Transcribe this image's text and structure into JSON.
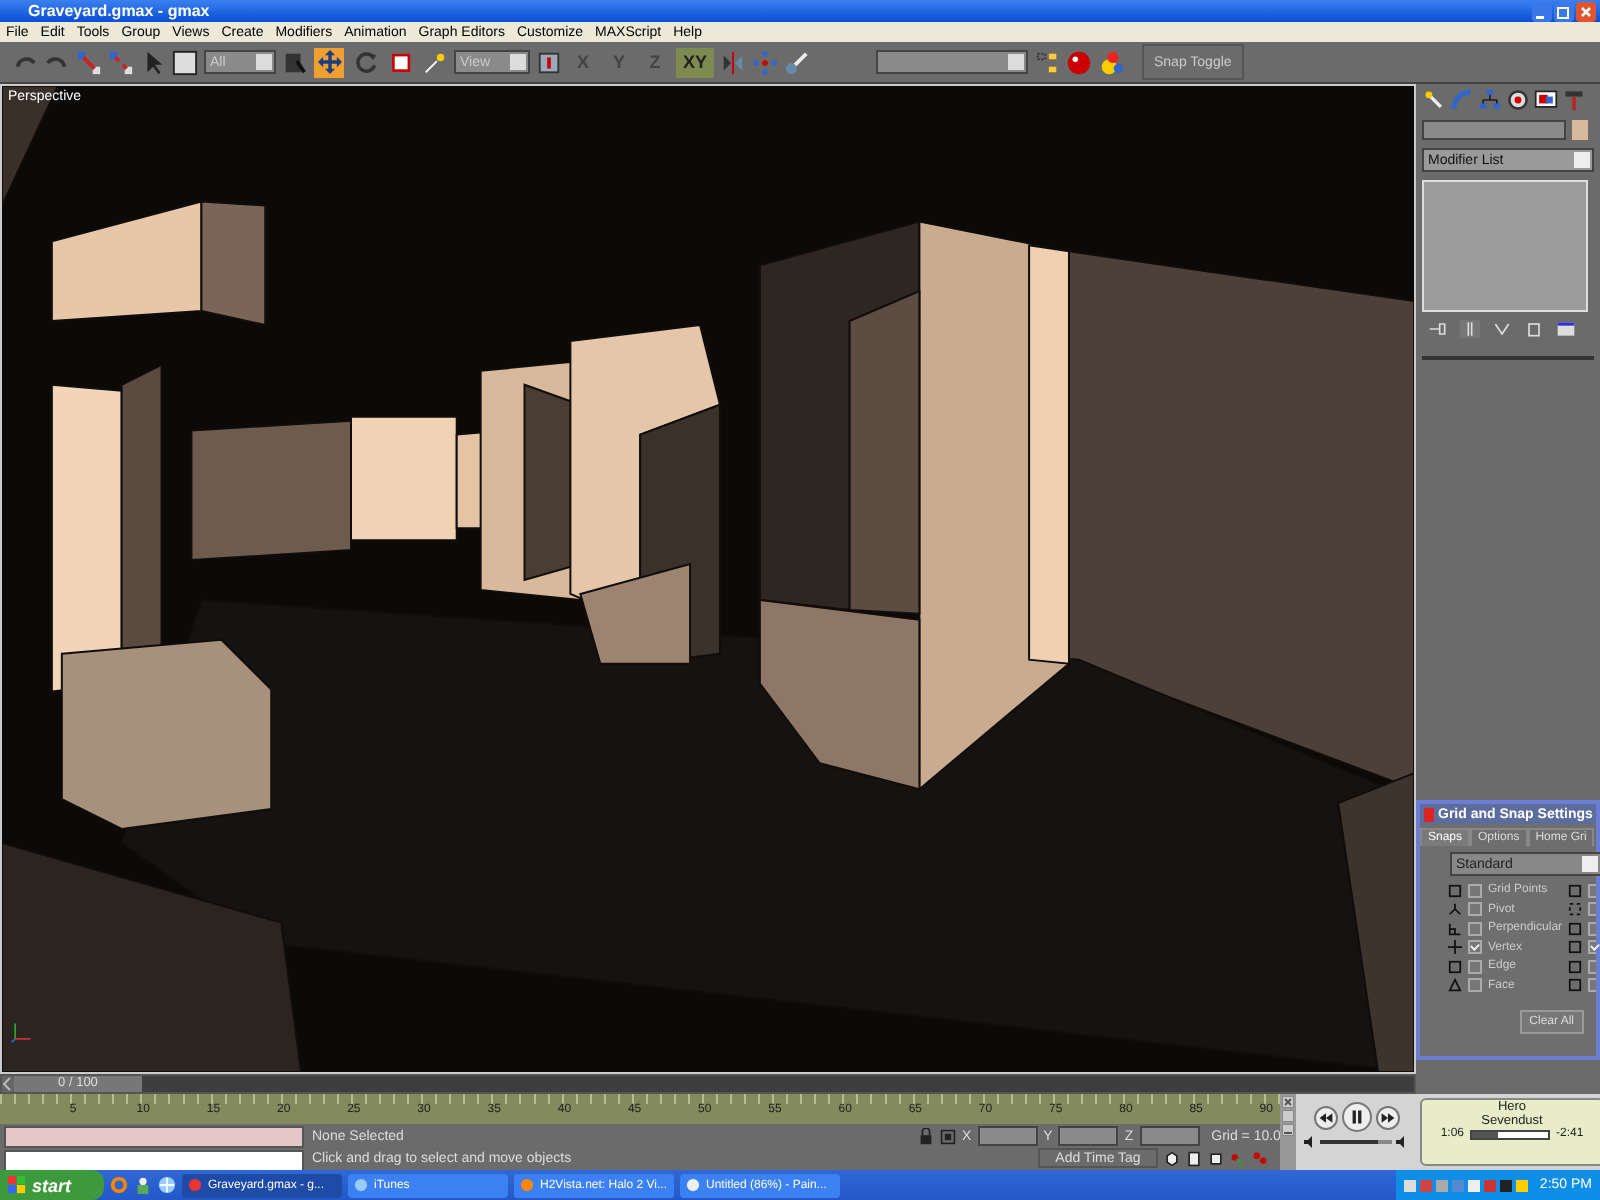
{
  "window": {
    "title": "Graveyard.gmax - gmax"
  },
  "menu": [
    "File",
    "Edit",
    "Tools",
    "Group",
    "Views",
    "Create",
    "Modifiers",
    "Animation",
    "Graph Editors",
    "Customize",
    "MAXScript",
    "Help"
  ],
  "toolbar": {
    "selection_filter": "All",
    "reference_coord": "View",
    "transform_tools": [
      {
        "selected": true
      },
      {
        "selected": false
      },
      {
        "selected": false
      }
    ],
    "axis_constraints": [
      {
        "label": "X",
        "selected": false
      },
      {
        "label": "Y",
        "selected": false
      },
      {
        "label": "Z",
        "selected": false
      },
      {
        "label": "XY",
        "selected": true
      }
    ],
    "snap_toggle": "Snap Toggle"
  },
  "viewport": {
    "label": "Perspective"
  },
  "command_panel": {
    "modifier_list": "Modifier List"
  },
  "grid_snap": {
    "title": "Grid and Snap Settings",
    "tabs": [
      {
        "label": "Snaps",
        "selected": true
      },
      {
        "label": "Options",
        "selected": false
      },
      {
        "label": "Home Gri",
        "selected": false
      }
    ],
    "preset": "Standard",
    "snaps": [
      {
        "label": "Grid Points",
        "checked": false
      },
      {
        "label": "Pivot",
        "checked": false
      },
      {
        "label": "Perpendicular",
        "checked": false
      },
      {
        "label": "Vertex",
        "checked": true
      },
      {
        "label": "Edge",
        "checked": false
      },
      {
        "label": "Face",
        "checked": false
      }
    ],
    "second_column": [
      {
        "checked": false
      },
      {
        "checked": false
      },
      {
        "checked": false
      },
      {
        "checked": true
      },
      {
        "checked": false
      },
      {
        "checked": false
      }
    ],
    "clear_all": "Clear All"
  },
  "time_slider": {
    "label": "0 / 100",
    "level": 0
  },
  "track_bar": {
    "ticks": [
      "5",
      "10",
      "15",
      "20",
      "25",
      "30",
      "35",
      "40",
      "45",
      "50",
      "55",
      "60",
      "65",
      "70",
      "75",
      "80",
      "85",
      "90"
    ]
  },
  "status": {
    "selection": "None Selected",
    "prompt": "Click and drag to select and move objects",
    "coords": [
      "X",
      "Y",
      "Z"
    ],
    "grid": "Grid = 10.0",
    "add_time_tag": "Add Time Tag"
  },
  "media_player": {
    "song": "Hero",
    "artist": "Sevendust",
    "elapsed": "1:06",
    "remaining": "-2:41",
    "level": 0.35,
    "volume": {
      "level": 0.8
    }
  },
  "taskbar": {
    "start": "start",
    "tasks": [
      {
        "label": "Graveyard.gmax - g...",
        "selected": true
      },
      {
        "label": "iTunes",
        "selected": false
      },
      {
        "label": "H2Vista.net: Halo 2 Vi...",
        "selected": false
      },
      {
        "label": "Untitled (86%) - Pain...",
        "selected": false
      }
    ],
    "clock": "2:50 PM"
  }
}
